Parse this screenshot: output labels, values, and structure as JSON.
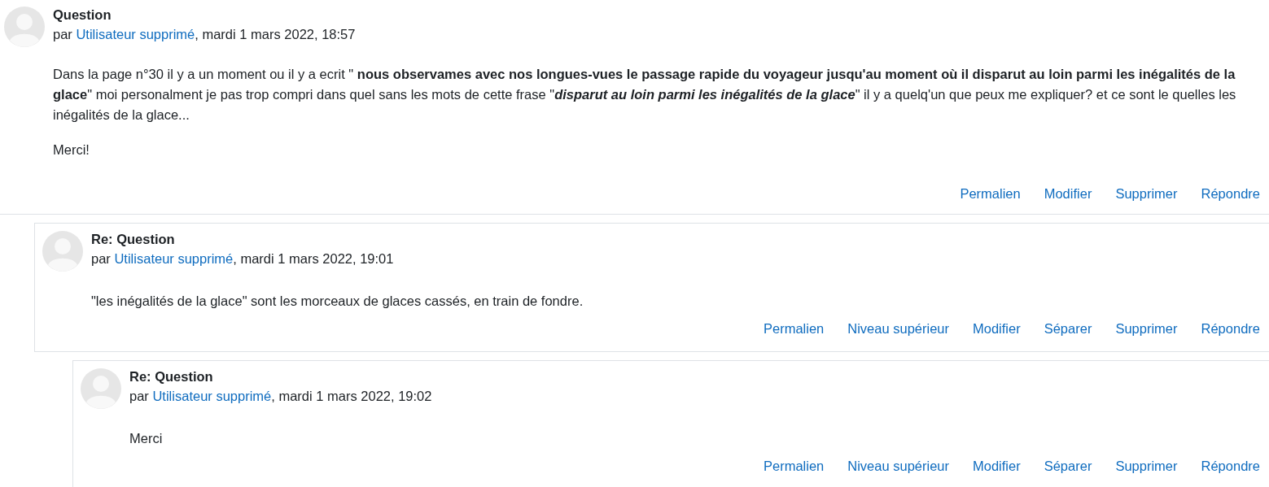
{
  "posts": [
    {
      "title": "Question",
      "byline_prefix": "par",
      "author": "Utilisateur supprimé",
      "date": ", mardi 1 mars 2022, 18:57",
      "framed": false,
      "paragraphs": [
        "Dans la page n°30 il y a un moment ou il y a ecrit \" **nous observames avec nos longues-vues le passage rapide du voyageur jusqu'au moment où il disparut au loin parmi les inégalités de la glace**\" moi personalment je pas trop compri dans quel sans les mots de cette frase \"*disparut au loin parmi les inégalités de la glace*\" il y a quelq'un que peux me expliquer? et ce sont le quelles les inégalités de la glace...",
        "Merci!"
      ],
      "actions": [
        "Permalien",
        "Modifier",
        "Supprimer",
        "Répondre"
      ],
      "children": [
        {
          "title": "Re: Question",
          "byline_prefix": "par",
          "author": "Utilisateur supprimé",
          "date": ", mardi 1 mars 2022, 19:01",
          "framed": true,
          "paragraphs": [
            "\"les inégalités de la glace\" sont les morceaux de glaces cassés, en train de fondre."
          ],
          "actions": [
            "Permalien",
            "Niveau supérieur",
            "Modifier",
            "Séparer",
            "Supprimer",
            "Répondre"
          ],
          "children": [
            {
              "title": "Re: Question",
              "byline_prefix": "par",
              "author": "Utilisateur supprimé",
              "date": ", mardi 1 mars 2022, 19:02",
              "framed": true,
              "paragraphs": [
                "Merci"
              ],
              "actions": [
                "Permalien",
                "Niveau supérieur",
                "Modifier",
                "Séparer",
                "Supprimer",
                "Répondre"
              ]
            }
          ]
        }
      ]
    }
  ]
}
